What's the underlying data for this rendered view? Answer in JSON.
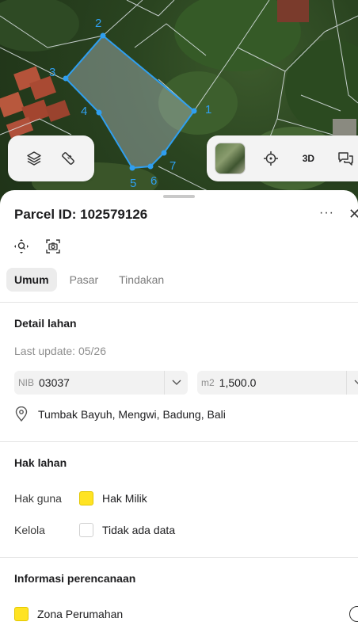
{
  "map": {
    "vertex_labels": [
      "1",
      "2",
      "3",
      "4",
      "5",
      "6",
      "7"
    ],
    "polygon_color": "#2f9ff0",
    "toolbar": {
      "layers_icon": "layers-icon",
      "measure_icon": "ruler-icon",
      "locate_icon": "crosshair-icon",
      "mode_3d_label": "3D",
      "feedback_icon": "chat-icon"
    }
  },
  "parcel": {
    "title": "Parcel ID: 102579126",
    "more_label": "···",
    "close_label": "✕"
  },
  "tabs": [
    {
      "label": "Umum",
      "active": true
    },
    {
      "label": "Pasar",
      "active": false
    },
    {
      "label": "Tindakan",
      "active": false
    }
  ],
  "detail": {
    "title": "Detail lahan",
    "last_update": "Last update: 05/26",
    "nib_prefix": "NIB",
    "nib_value": "03037",
    "area_prefix": "m2",
    "area_value": "1,500.0",
    "location": "Tumbak Bayuh, Mengwi, Badung, Bali"
  },
  "hak": {
    "title": "Hak lahan",
    "rows": [
      {
        "key": "Hak guna",
        "value": "Hak Milik",
        "color": "#ffe323"
      },
      {
        "key": "Kelola",
        "value": "Tidak ada data",
        "color": "#ffffff"
      }
    ]
  },
  "planning": {
    "title": "Informasi perencanaan",
    "zone_label": "Zona Perumahan",
    "zone_color": "#ffe323"
  }
}
